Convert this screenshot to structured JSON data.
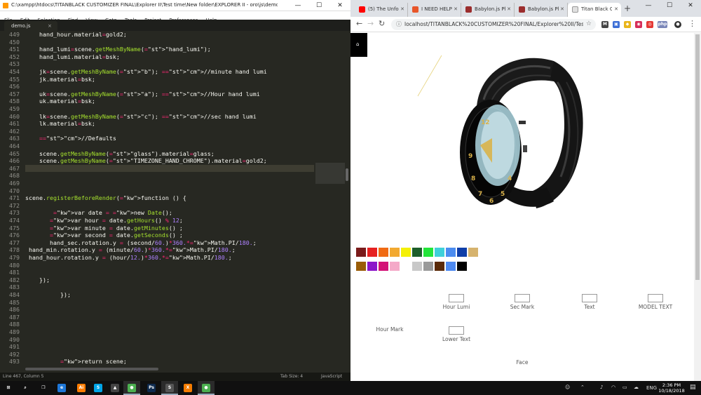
{
  "sublime": {
    "title": "C:\\xampp\\htdocs\\TITANBLACK CUSTOMIZER FINAL\\Explorer II\\Test time\\New folder\\EXPLORER II - oro\\js\\demo.js - Sublime Text 2 (UNREGISTE...",
    "menu": [
      "File",
      "Edit",
      "Selection",
      "Find",
      "View",
      "Goto",
      "Tools",
      "Project",
      "Preferences",
      "Help"
    ],
    "tab_name": "demo.js",
    "tab_close": "×",
    "status_left": "Line 467, Column 5",
    "status_tab": "Tab Size: 4",
    "status_syntax": "JavaScript",
    "line_numbers": [
      "449",
      "450",
      "451",
      "452",
      "453",
      "454",
      "455",
      "456",
      "457",
      "458",
      "459",
      "460",
      "461",
      "462",
      "463",
      "464",
      "465",
      "466",
      "467",
      "468",
      "469",
      "470",
      "471",
      "472",
      "473",
      "474",
      "475",
      "476",
      "477",
      "478",
      "479",
      "480",
      "481",
      "482",
      "483",
      "484",
      "485",
      "486",
      "487",
      "488",
      "489",
      "490",
      "491",
      "492",
      "493"
    ],
    "code_lines": [
      "    hand_hour.material=gold2;",
      "",
      "    hand_lumi=scene.getMeshByName(\"hand_lumi\");",
      "    hand_lumi.material=bsk;",
      "",
      "    jk=scene.getMeshByName(\"b\"); //minute hand lumi",
      "    jk.material=bsk;",
      "",
      "    uk=scene.getMeshByName(\"a\"); //Hour hand lumi",
      "    uk.material=bsk;",
      "",
      "    lk=scene.getMeshByName(\"c\"); //sec hand lumi",
      "    lk.material=bsk;",
      "",
      "    //Defaults",
      "",
      "    scene.getMeshByName(\"glass\").material=glass;",
      "    scene.getMeshByName(\"TIMEZONE_HAND_CHROME\").material=gold2;",
      "",
      "",
      "",
      "",
      "scene.registerBeforeRender(function () {",
      "",
      "        var date = new Date();",
      "       var hour = date.getHours() % 12;",
      "       var minute = date.getMinutes() ;",
      "       var second = date.getSeconds() ;",
      "       hand_sec.rotation.y = (second/60.)*360.*Math.PI/180.;",
      " hand_min.rotation.y = (minute/60.)*360.*Math.PI/180.;",
      " hand_hour.rotation.y = (hour/12.)*360.*Math.PI/180.;",
      "",
      "",
      "    });",
      "",
      "          });",
      "",
      "",
      "",
      "",
      "",
      "",
      "",
      "",
      "          return scene;"
    ]
  },
  "chrome": {
    "tabs": [
      {
        "label": "(5) The Unforgi...",
        "color": "#ff0000"
      },
      {
        "label": "I NEED HELP IN...",
        "color": "#e8562a"
      },
      {
        "label": "Babylon.js Playg...",
        "color": "#9b2d2d"
      },
      {
        "label": "Babylon.js Playg...",
        "color": "#9b2d2d"
      },
      {
        "label": "Titan Black Cus...",
        "color": "#888888"
      }
    ],
    "url": "localhost/TITANBLACK%20CUSTOMIZER%20FINAL/Explorer%20II/Test%20tim...",
    "extensions": [
      {
        "label": "M",
        "color": "#444444"
      },
      {
        "label": "▣",
        "color": "#3c6ed6"
      },
      {
        "label": "◆",
        "color": "#e9b51b"
      },
      {
        "label": "◉",
        "color": "#d62e5a"
      },
      {
        "label": "◎",
        "color": "#e53935"
      },
      {
        "label": "php",
        "color": "#7a86b8"
      },
      {
        "label": "●",
        "color": "#333333"
      }
    ],
    "canvas_button": "⌂",
    "swatches_row1": [
      "#7a1b1b",
      "#e62121",
      "#f06a13",
      "#f2a931",
      "#f4f007",
      "#1d5e2a",
      "#23e43a",
      "#3fd0d9",
      "#4b8cf0",
      "#0f3ea8",
      "#d6b36e"
    ],
    "swatches_row2": [
      "#9a5d08",
      "#8c16c9",
      "#d31277",
      "#f4a9c8",
      "#ffffff",
      "#c8c8c8",
      "#9a9a9a",
      "#5a2a08",
      "#4d89f0",
      "#000000"
    ],
    "options": [
      {
        "label": "Hour Lumi"
      },
      {
        "label": "Sec Mark"
      },
      {
        "label": "Text"
      },
      {
        "label": "MODEL TEXT"
      },
      {
        "label": "Hour Mark"
      },
      {
        "label": "Lower Text"
      },
      {
        "label": "Face"
      }
    ]
  },
  "taskbar": {
    "apps": [
      {
        "name": "start",
        "label": "⊞",
        "color": "#101010"
      },
      {
        "name": "search",
        "label": "⌕",
        "color": "#101010"
      },
      {
        "name": "task-view",
        "label": "❒",
        "color": "#101010"
      },
      {
        "name": "edge",
        "label": "e",
        "color": "#1e77d8"
      },
      {
        "name": "illustrator",
        "label": "Ai",
        "color": "#ff7c00"
      },
      {
        "name": "skype",
        "label": "S",
        "color": "#00a5e8"
      },
      {
        "name": "game",
        "label": "▲",
        "color": "#444444"
      },
      {
        "name": "chrome",
        "label": "●",
        "color": "#4caf50"
      },
      {
        "name": "photoshop",
        "label": "Ps",
        "color": "#0e2a4e"
      },
      {
        "name": "sublime",
        "label": "S",
        "color": "#555555"
      },
      {
        "name": "xampp",
        "label": "X",
        "color": "#f57c00"
      },
      {
        "name": "chrome2",
        "label": "●",
        "color": "#4caf50"
      }
    ],
    "tray_lang": "ENG",
    "time": "2:36 PM",
    "date": "10/18/2018"
  }
}
